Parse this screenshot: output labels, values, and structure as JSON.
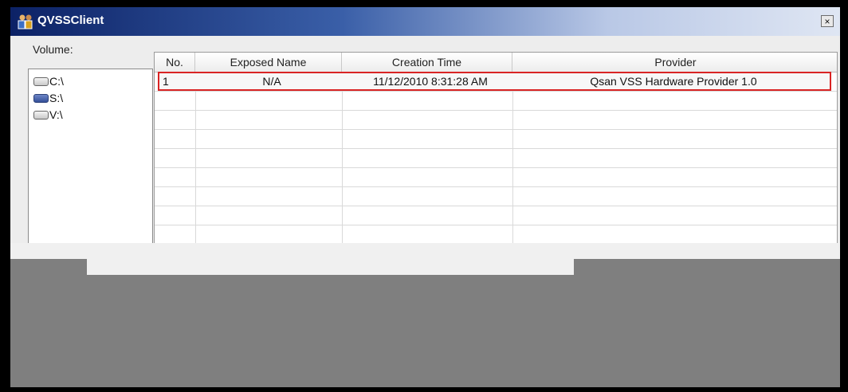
{
  "window": {
    "title": "QVSSClient",
    "close_glyph": "×",
    "app_icon": "app-icon"
  },
  "volume": {
    "label": "Volume:",
    "items": [
      {
        "label": "C:\\",
        "selected": false
      },
      {
        "label": "S:\\",
        "selected": true
      },
      {
        "label": "V:\\",
        "selected": false
      }
    ]
  },
  "table": {
    "columns": [
      "No.",
      "Exposed Name",
      "Creation Time",
      "Provider"
    ],
    "rows": [
      {
        "no": "1",
        "exposed_name": "N/A",
        "creation_time": "11/12/2010 8:31:28 AM",
        "provider": "Qsan VSS Hardware Provider 1.0"
      }
    ],
    "highlight_color": "#d92424"
  }
}
